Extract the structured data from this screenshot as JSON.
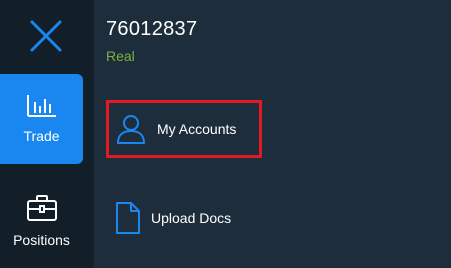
{
  "account": {
    "number": "76012837",
    "type": "Real"
  },
  "nav": {
    "trade_label": "Trade",
    "positions_label": "Positions",
    "trade_icon": "chart-bars-icon",
    "positions_icon": "briefcase-icon",
    "close_icon": "close-icon"
  },
  "menu": {
    "accounts_label": "My Accounts",
    "upload_label": "Upload Docs",
    "accounts_icon": "user-icon",
    "upload_icon": "document-icon"
  },
  "colors": {
    "accent": "#1a87f0",
    "real_badge": "#79b33d",
    "highlight": "#e01b24",
    "background": "#1e2d3c",
    "rail": "#121e28"
  }
}
